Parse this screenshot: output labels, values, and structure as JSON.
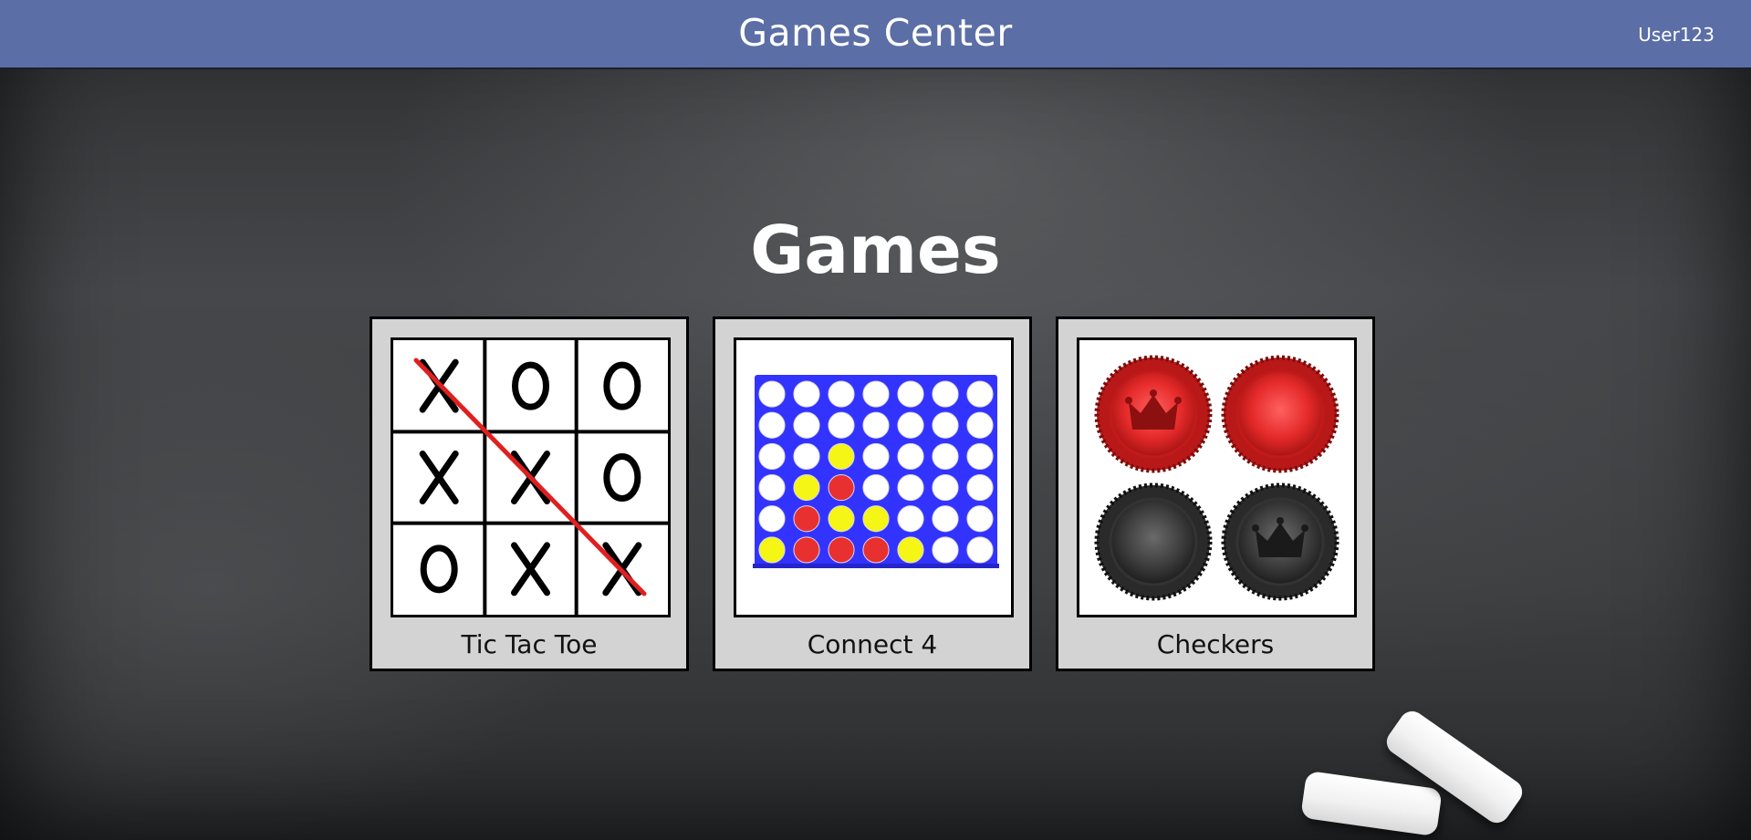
{
  "header": {
    "title": "Games Center",
    "user": "User123"
  },
  "main": {
    "heading": "Games",
    "games": [
      {
        "label": "Tic Tac Toe",
        "icon": "tic-tac-toe-board-icon"
      },
      {
        "label": "Connect 4",
        "icon": "connect-four-board-icon"
      },
      {
        "label": "Checkers",
        "icon": "checkers-pieces-icon"
      }
    ]
  },
  "tic_tac_toe": {
    "cells": [
      "X",
      "O",
      "O",
      "X",
      "X",
      "O",
      "O",
      "X",
      "X"
    ]
  },
  "connect4": {
    "grid": [
      [
        "",
        "",
        "",
        "",
        "",
        "",
        ""
      ],
      [
        "",
        "",
        "",
        "",
        "",
        "",
        ""
      ],
      [
        "",
        "",
        "Y",
        "",
        "",
        "",
        ""
      ],
      [
        "",
        "Y",
        "R",
        "",
        "",
        "",
        ""
      ],
      [
        "",
        "R",
        "Y",
        "Y",
        "",
        "",
        ""
      ],
      [
        "Y",
        "R",
        "R",
        "R",
        "Y",
        "",
        ""
      ]
    ]
  },
  "colors": {
    "header_bar": "#5b6ea6",
    "card_bg": "#d3d3d3",
    "connect4_board": "#3333ff",
    "piece_red": "#e83030",
    "piece_yellow": "#f5f516",
    "win_line": "#e02020"
  }
}
